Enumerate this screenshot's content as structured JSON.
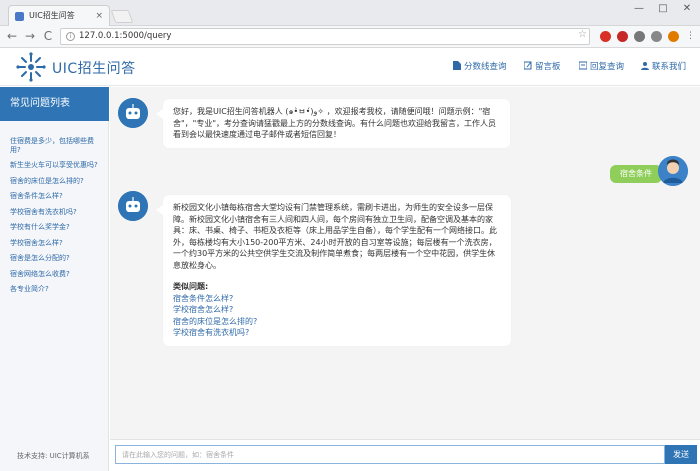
{
  "browser": {
    "tab_title": "UIC招生问答",
    "tab_close": "×",
    "url": "127.0.0.1:5000/query",
    "back": "←",
    "forward": "→",
    "reload": "C",
    "star": "☆",
    "win_minimize": "—",
    "win_maximize": "□",
    "win_close": "✕"
  },
  "header": {
    "logo_text": "UIC招生问答",
    "nav": [
      {
        "label": "分数线查询",
        "icon": "document-icon"
      },
      {
        "label": "留言板",
        "icon": "edit-icon"
      },
      {
        "label": "回复查询",
        "icon": "reply-icon"
      },
      {
        "label": "联系我们",
        "icon": "contacts-icon"
      }
    ]
  },
  "sidebar": {
    "title": "常见问题列表",
    "items": [
      "住宿费是多少，包括哪些费用?",
      "新生坐火车可以享受优惠吗?",
      "宿舍的床位是怎么排的?",
      "宿舍条件怎么样?",
      "学校宿舍有洗衣机吗?",
      "学校有什么奖学金?",
      "学校宿舍怎么样?",
      "宿舍是怎么分配的?",
      "宿舍网络怎么收费?",
      "各专业简介?"
    ],
    "footer": "技术支持: UIC计算机系"
  },
  "chat": {
    "bot_greeting": "您好，我是UIC招生问答机器人 (๑•̀ㅂ•́)و✧ ，欢迎报考我校，请随便问哦！问题示例：\"宿舍\"，\"专业\"，考分查询请猛戳最上方的分数线查询。有什么问题也欢迎给我留言，工作人员看到会以最快速度通过电子邮件或者短信回复！",
    "user_message": "宿舍条件",
    "bot_answer": "新校园文化小镇每栋宿舍大堂均设有门禁管理系统，需刷卡进出，为师生的安全设多一层保障。新校园文化小镇宿舍有三人间和四人间，每个房间有独立卫生间，配备空调及基本的家具：床、书桌、椅子、书柜及衣柜等（床上用品学生自备），每个学生配有一个网络接口。此外，每栋楼均有大小150-200平方米、24小时开放的自习室等设施；每层楼有一个洗衣房，一个约30平方米的公共空供学生交流及制作简单煮食；每两层楼有一个空中花园，供学生休息放松身心。",
    "similar_title": "类似问题:",
    "similar": [
      "宿舍条件怎么样?",
      "学校宿舍怎么样?",
      "宿舍的床位是怎么排的?",
      "学校宿舍有洗衣机吗?"
    ]
  },
  "input": {
    "placeholder": "请在此输入您的问题，如：宿舍条件",
    "send_label": "发送"
  },
  "colors": {
    "primary": "#2f75b5",
    "user_bubble": "#8fce5a",
    "link": "#2f6aa8"
  }
}
